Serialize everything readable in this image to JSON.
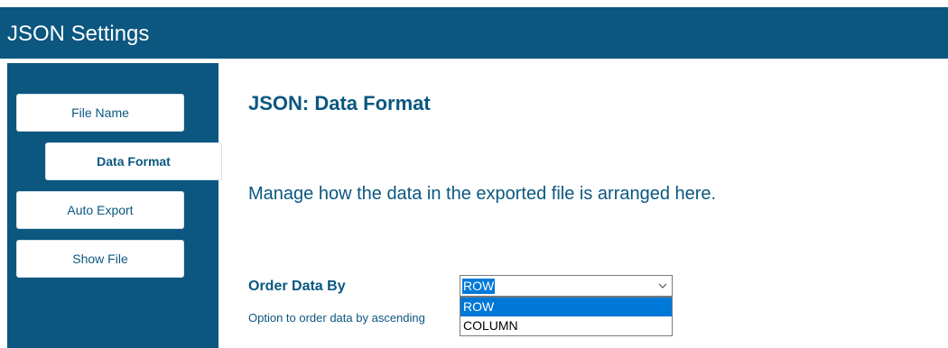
{
  "window": {
    "title": "JSON Settings"
  },
  "sidebar": {
    "items": [
      {
        "label": "File Name"
      },
      {
        "label": "Data Format"
      },
      {
        "label": "Auto Export"
      },
      {
        "label": "Show File"
      }
    ],
    "active": "Data Format"
  },
  "main": {
    "heading": "JSON: Data Format",
    "description": "Manage how the data in the exported file is arranged here.",
    "order_setting": {
      "label": "Order Data By",
      "help_text": "Option to order data by ascending",
      "selected": "ROW",
      "options": [
        "ROW",
        "COLUMN"
      ],
      "highlighted_option": "ROW"
    }
  },
  "colors": {
    "brand": "#0b5780",
    "selection": "#0078d7",
    "background": "#ffffff"
  },
  "icons": {
    "dropdown": "chevron-down-icon"
  }
}
